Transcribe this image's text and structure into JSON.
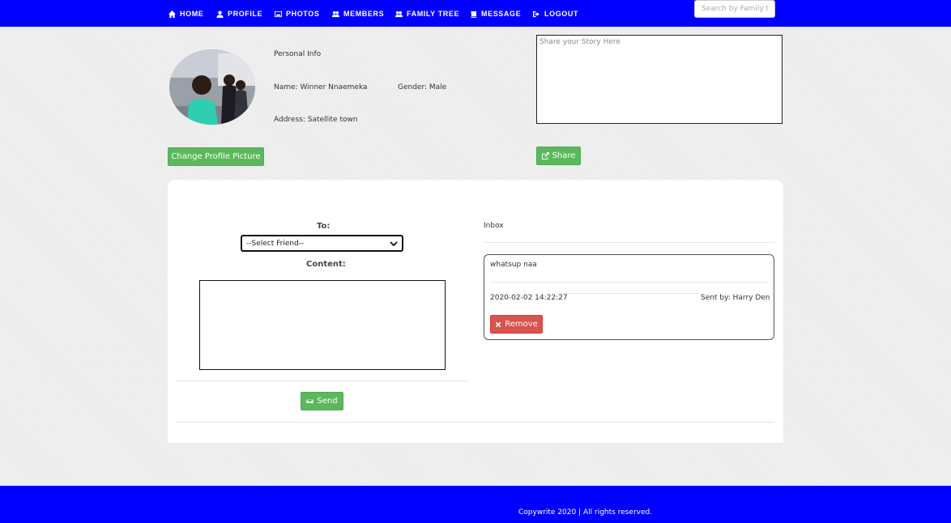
{
  "nav": {
    "items": [
      {
        "label": "HOME",
        "icon": "home-icon"
      },
      {
        "label": "PROFILE",
        "icon": "user-icon"
      },
      {
        "label": "PHOTOS",
        "icon": "picture-icon"
      },
      {
        "label": "MEMBERS",
        "icon": "users-icon"
      },
      {
        "label": "FAMILY TREE",
        "icon": "users-icon"
      },
      {
        "label": "MESSAGE",
        "icon": "book-icon"
      },
      {
        "label": "LOGOUT",
        "icon": "sign-out-icon"
      }
    ],
    "search_placeholder": "Search by Family t",
    "bar_color": "#0000ff"
  },
  "profile": {
    "section_title": "Personal Info",
    "name": "Name: Winner Nnaemeka",
    "gender": "Gender: Male",
    "address": "Address: Satellite town",
    "change_picture_label": "Change Profile Picture"
  },
  "story": {
    "placeholder": "Share your Story Here",
    "share_label": "Share"
  },
  "compose": {
    "to_label": "To:",
    "select_value": "--Select Friend--",
    "content_label": "Content:",
    "send_label": "Send"
  },
  "inbox": {
    "title": "Inbox",
    "messages": [
      {
        "text": "whatsup naa",
        "timestamp": "2020-02-02 14:22:27",
        "sender": "Sent by: Harry Den",
        "remove_label": "Remove"
      }
    ]
  },
  "footer": {
    "text": "Copywrite 2020 | All rights reserved."
  },
  "colors": {
    "primary": "#0000ff",
    "success": "#5cb85c",
    "danger": "#d9534f"
  }
}
